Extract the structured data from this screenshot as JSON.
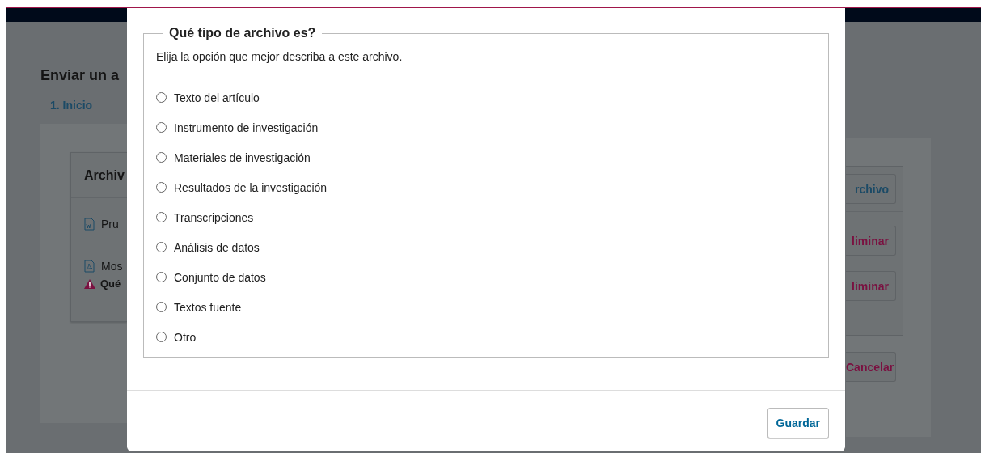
{
  "background_page": {
    "title": "Enviar un a",
    "tab": "1. Inicio",
    "card_title": "Archiv",
    "files": [
      {
        "kind": "word",
        "name": "Pru",
        "action": "liminar"
      },
      {
        "kind": "pdf",
        "name": "Mos",
        "action": "liminar"
      }
    ],
    "warning": "Qué",
    "add_button": "rchivo",
    "cancel_button": "Cancelar"
  },
  "dialog": {
    "legend": "Qué tipo de archivo es?",
    "description": "Elija la opción que mejor describa a este archivo.",
    "options": [
      {
        "label": "Texto del artículo",
        "selected": false
      },
      {
        "label": "Instrumento de investigación",
        "selected": false
      },
      {
        "label": "Materiales de investigación",
        "selected": false
      },
      {
        "label": "Resultados de la investigación",
        "selected": false
      },
      {
        "label": "Transcripciones",
        "selected": false
      },
      {
        "label": "Análisis de datos",
        "selected": false
      },
      {
        "label": "Conjunto de datos",
        "selected": false
      },
      {
        "label": "Textos fuente",
        "selected": false
      },
      {
        "label": "Otro",
        "selected": false
      }
    ],
    "save_button": "Guardar"
  }
}
